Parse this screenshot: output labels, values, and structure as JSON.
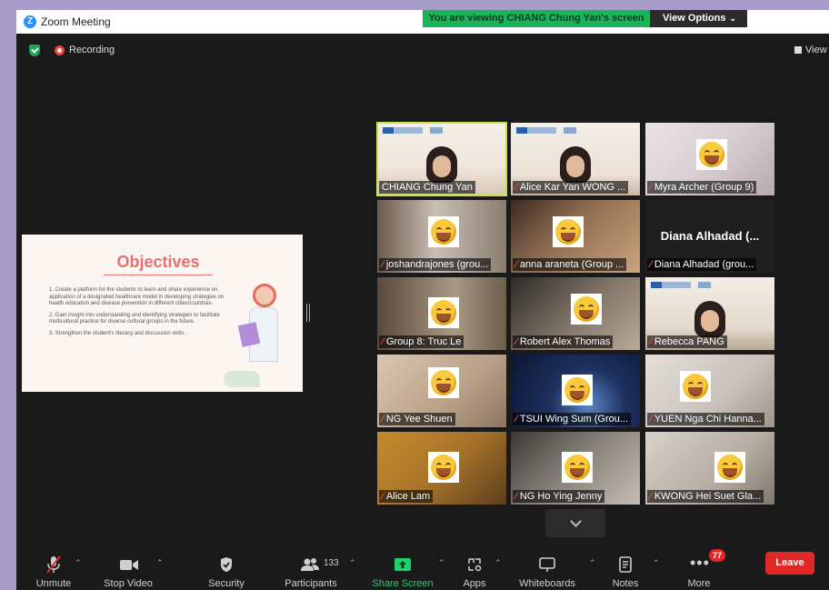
{
  "window": {
    "title": "Zoom Meeting"
  },
  "banner": {
    "message": "You are viewing CHIANG Chung Yan's screen",
    "view_options": "View Options"
  },
  "status": {
    "recording": "Recording",
    "view": "View"
  },
  "slide": {
    "title": "Objectives",
    "points": [
      "1.  Create a platform for the students to learn and share experience on application of a designated healthcare model in developing strategies on health education and disease prevention in different cities/countries.",
      "2.  Gain insight into understanding and identifying strategies to facilitate multicultural practice for diverse cultural groups in the future.",
      "3.  Strengthen the student's literacy and discussion skills."
    ]
  },
  "participants": [
    {
      "name": "CHIANG Chung Yan",
      "muted": false,
      "type": "video"
    },
    {
      "name": "Alice Kar Yan WONG ...",
      "muted": true,
      "type": "video"
    },
    {
      "name": "Myra Archer (Group 9)",
      "muted": true,
      "type": "emoji"
    },
    {
      "name": "joshandrajones (grou...",
      "muted": true,
      "type": "emoji"
    },
    {
      "name": "anna araneta (Group ...",
      "muted": true,
      "type": "emoji"
    },
    {
      "name": "Diana Alhadad (grou...",
      "muted": true,
      "type": "text",
      "display": "Diana Alhadad (..."
    },
    {
      "name": "Group 8: Truc Le",
      "muted": true,
      "type": "emoji"
    },
    {
      "name": "Robert Alex Thomas",
      "muted": true,
      "type": "emoji"
    },
    {
      "name": "Rebecca PANG",
      "muted": true,
      "type": "video"
    },
    {
      "name": "NG Yee Shuen",
      "muted": true,
      "type": "emoji"
    },
    {
      "name": "TSUI Wing Sum (Grou...",
      "muted": true,
      "type": "emoji"
    },
    {
      "name": "YUEN Nga Chi Hanna...",
      "muted": true,
      "type": "emoji"
    },
    {
      "name": "Alice Lam",
      "muted": true,
      "type": "emoji"
    },
    {
      "name": "NG Ho Ying Jenny",
      "muted": true,
      "type": "emoji"
    },
    {
      "name": "KWONG Hei Suet Gla...",
      "muted": true,
      "type": "emoji"
    }
  ],
  "toolbar": {
    "unmute": "Unmute",
    "stop_video": "Stop Video",
    "security": "Security",
    "participants": "Participants",
    "participants_count": "133",
    "share_screen": "Share Screen",
    "apps": "Apps",
    "whiteboards": "Whiteboards",
    "notes": "Notes",
    "more": "More",
    "more_badge": "77",
    "leave": "Leave"
  },
  "colors": {
    "accent_green": "#1bb35a",
    "leave_red": "#e02828",
    "active_speaker": "#c5e24e"
  }
}
